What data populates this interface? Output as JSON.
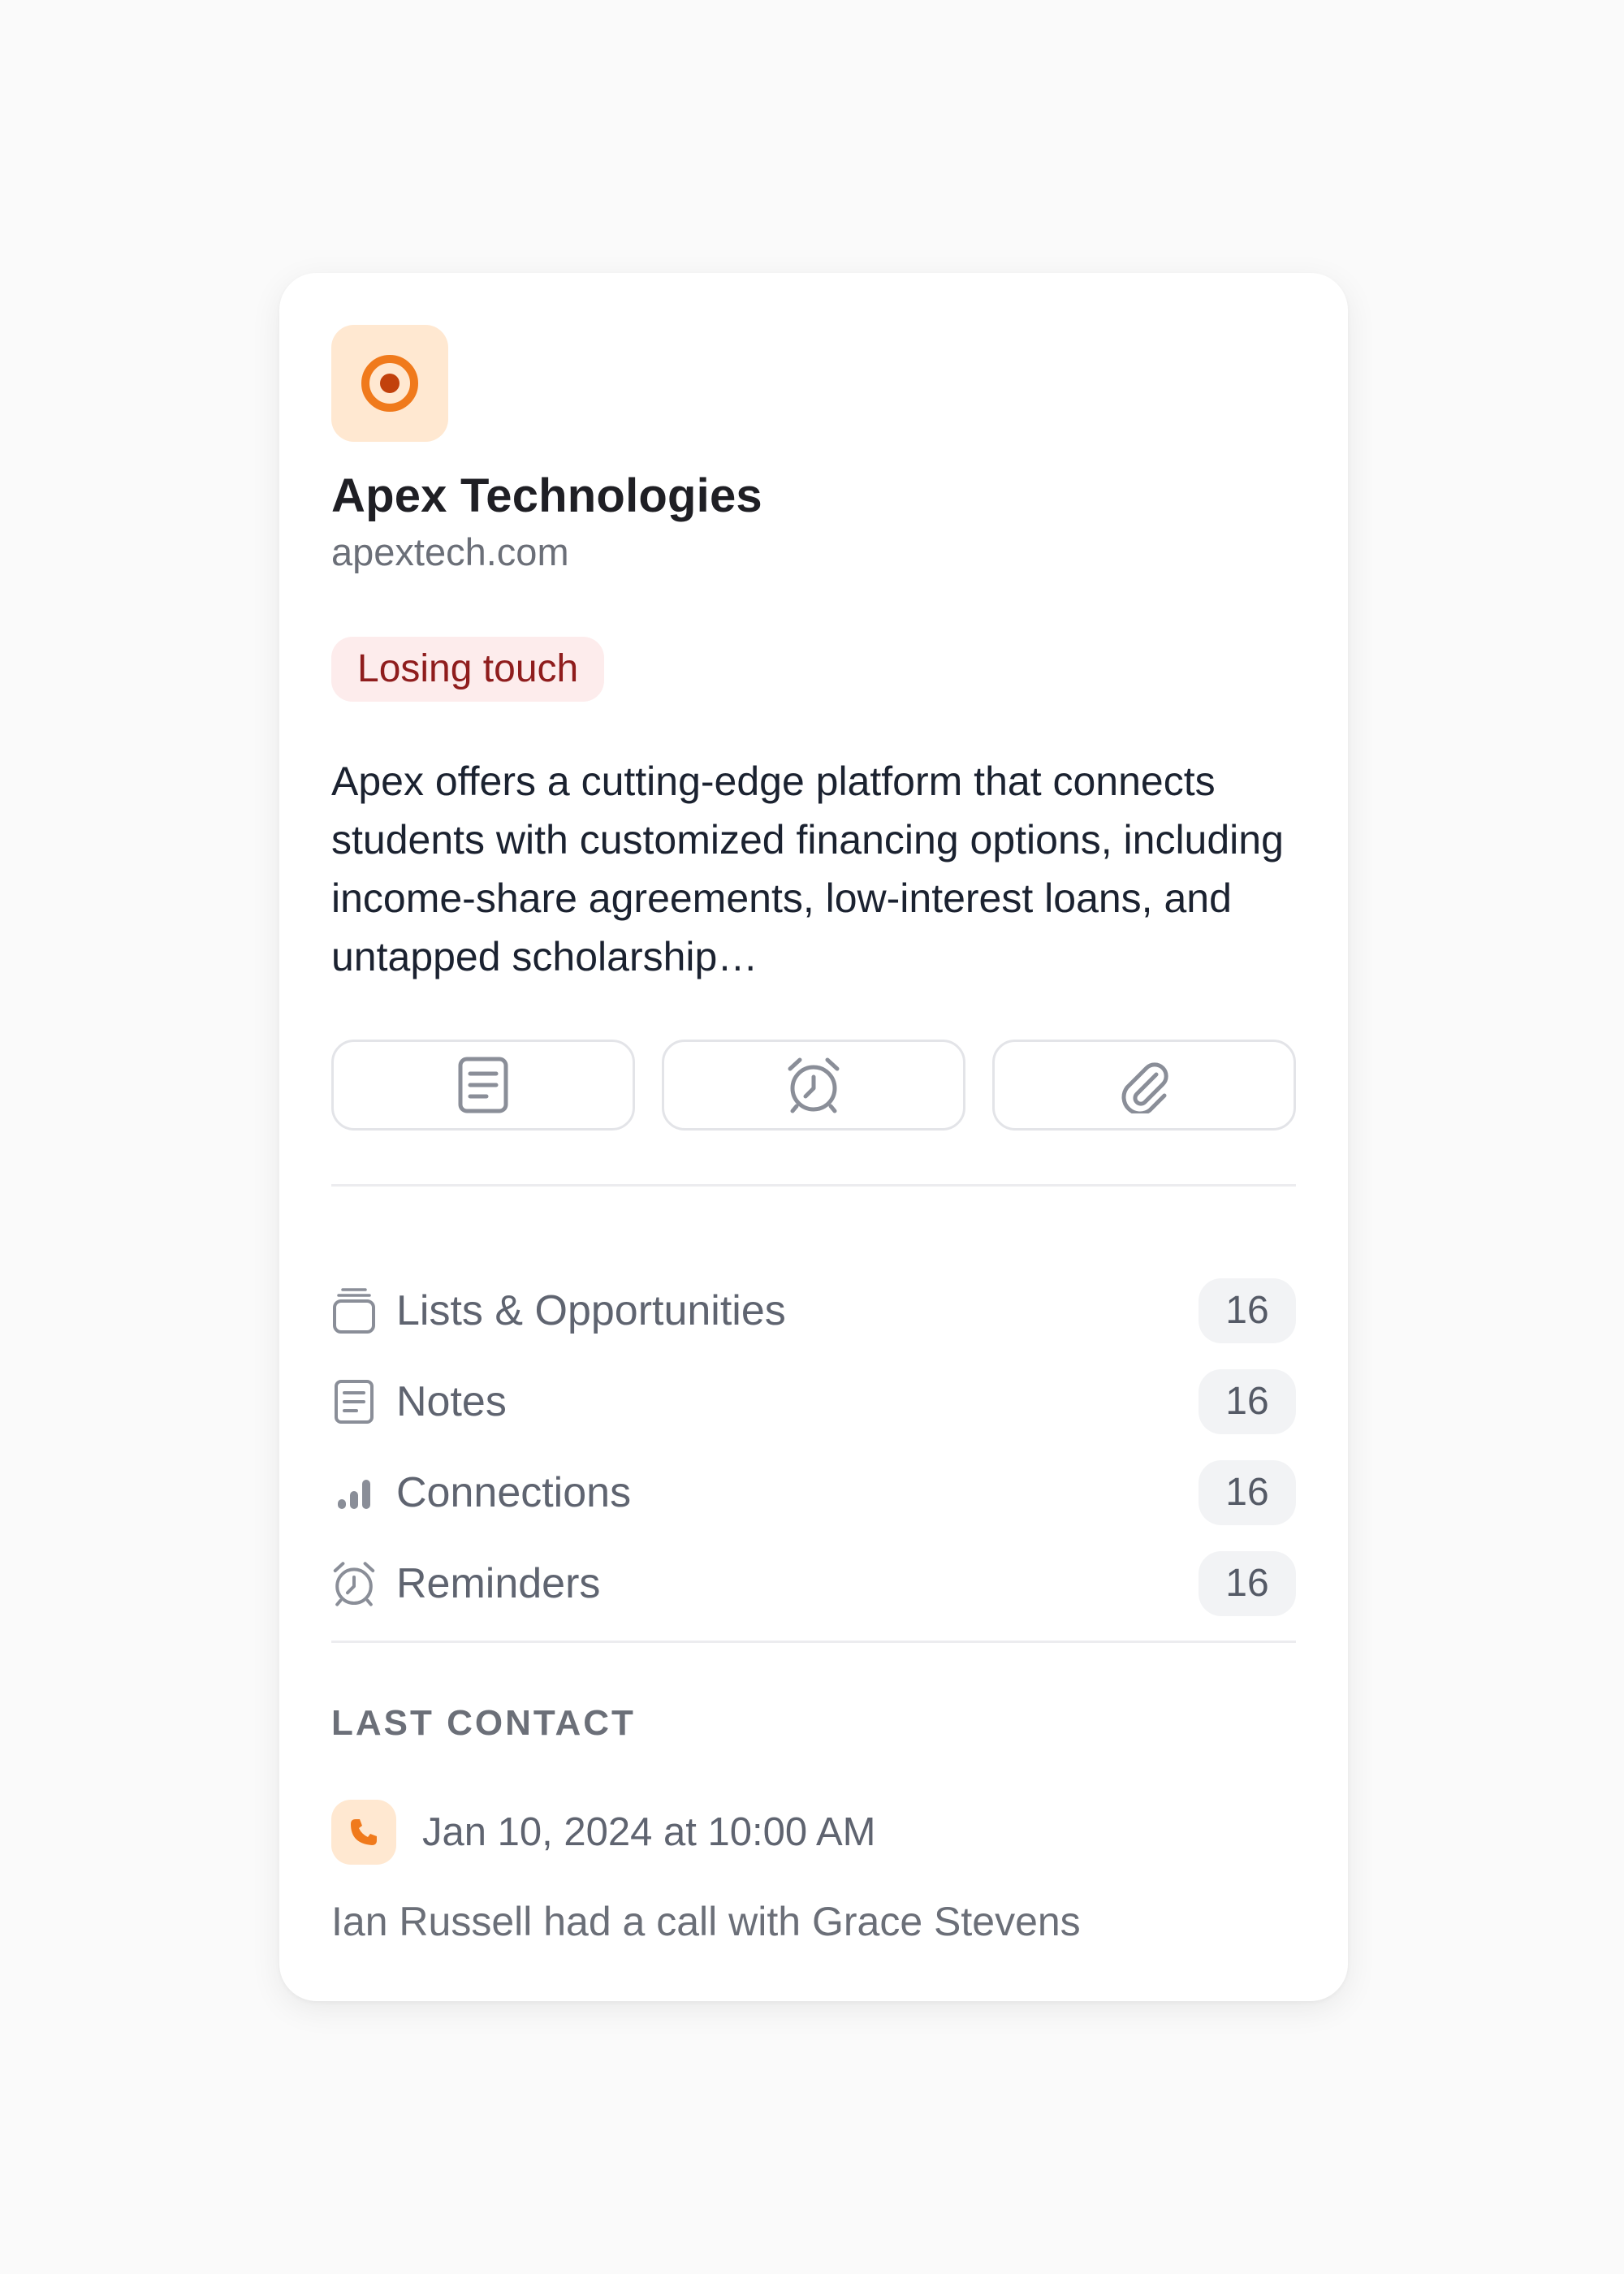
{
  "company": {
    "name": "Apex Technologies",
    "domain": "apextech.com",
    "logo_icon": "target-icon",
    "status_badge": "Losing touch",
    "description": "Apex offers a cutting-edge platform that connects students with customized financing options, including income-share agreements, low-interest loans, and untapped scholarship…"
  },
  "actions": [
    {
      "icon": "note-icon"
    },
    {
      "icon": "alarm-clock-icon"
    },
    {
      "icon": "paperclip-icon"
    }
  ],
  "sections": [
    {
      "label": "Lists & Opportunities",
      "count": "16",
      "icon": "stack-icon"
    },
    {
      "label": "Notes",
      "count": "16",
      "icon": "note-icon"
    },
    {
      "label": "Connections",
      "count": "16",
      "icon": "signal-bars-icon"
    },
    {
      "label": "Reminders",
      "count": "16",
      "icon": "alarm-clock-icon"
    }
  ],
  "last_contact": {
    "heading": "LAST CONTACT",
    "icon": "phone-icon",
    "date": "Jan 10, 2024 at 10:00 AM",
    "summary": "Ian Russell had a call with Grace Stevens"
  },
  "colors": {
    "accent": "#f07a1c",
    "accent_bg": "#ffe8d1",
    "badge_bg": "#fdecec",
    "badge_text": "#8f1d1d"
  }
}
